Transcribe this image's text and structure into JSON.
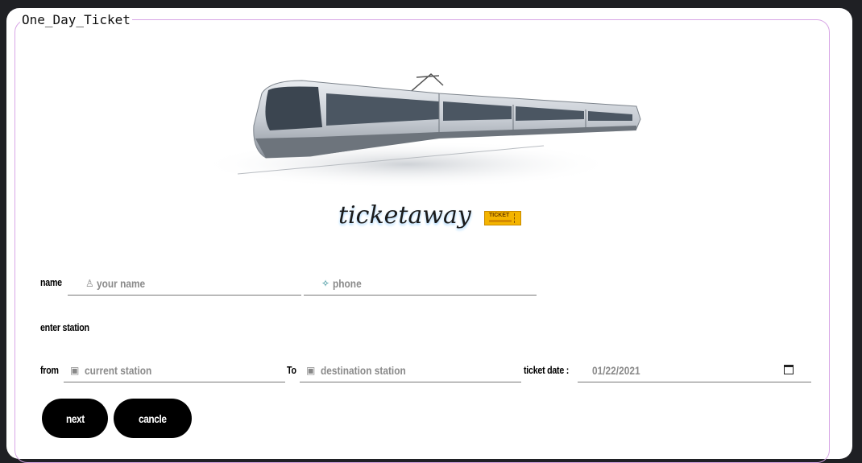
{
  "form": {
    "legend": "One_Day_Ticket",
    "brand": "ticketaway",
    "ticket_badge_text": "TICKET"
  },
  "labels": {
    "name": "name",
    "enter_station": "enter station",
    "from": "from",
    "to": "To",
    "ticket_date": "ticket date :"
  },
  "fields": {
    "name_placeholder": "your name",
    "phone_placeholder": "phone",
    "from_placeholder": "current station",
    "to_placeholder": "destination station",
    "date_value": "01/22/2021"
  },
  "icons": {
    "name": "person-icon",
    "phone": "phone-icon",
    "from": "train-icon",
    "to": "train-icon",
    "date": "calendar-icon"
  },
  "buttons": {
    "next": "next",
    "cancel": "cancle"
  },
  "colors": {
    "fieldset_border": "#d8a6e6",
    "button_bg": "#000000",
    "placeholder": "#8a8a8a",
    "phone_icon": "#1a7f8a"
  }
}
